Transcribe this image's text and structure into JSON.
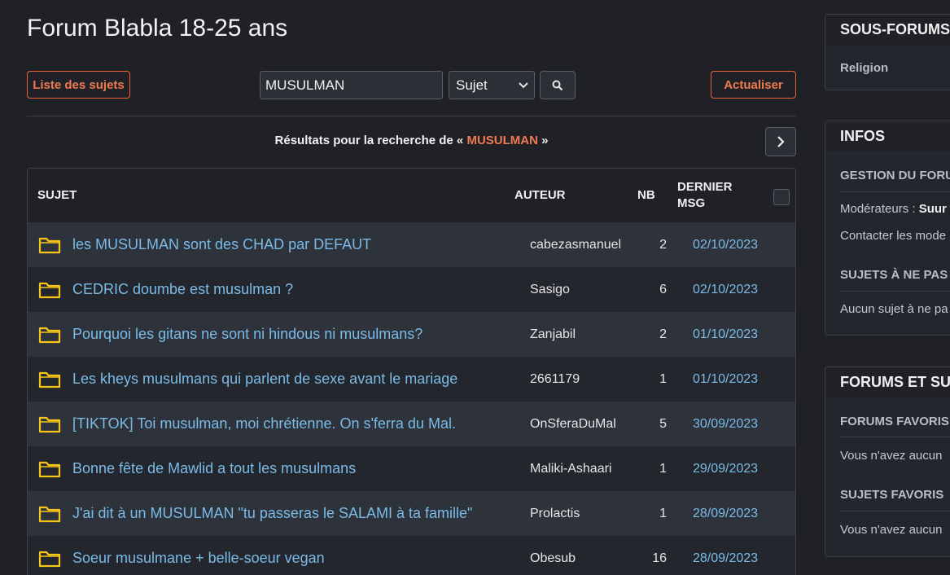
{
  "header": {
    "title": "Forum Blabla 18-25 ans"
  },
  "toolbar": {
    "list_label": "Liste des sujets",
    "search_value": "MUSULMAN",
    "search_type": "Sujet",
    "refresh_label": "Actualiser"
  },
  "results": {
    "prefix": "Résultats pour la recherche de «",
    "term": "MUSULMAN",
    "suffix": "»"
  },
  "table": {
    "headers": {
      "sujet": "SUJET",
      "auteur": "AUTEUR",
      "nb": "NB",
      "dernier_1": "DERNIER",
      "dernier_2": "MSG"
    },
    "rows": [
      {
        "subject": "les MUSULMAN sont des CHAD par DEFAUT",
        "author": "cabezasmanuel",
        "nb": "2",
        "date": "02/10/2023"
      },
      {
        "subject": "CEDRIC doumbe est musulman ?",
        "author": "Sasigo",
        "nb": "6",
        "date": "02/10/2023"
      },
      {
        "subject": "Pourquoi les gitans ne sont ni hindous ni musulmans?",
        "author": "Zanjabil",
        "nb": "2",
        "date": "01/10/2023"
      },
      {
        "subject": "Les kheys musulmans qui parlent de sexe avant le mariage",
        "author": "2661179",
        "nb": "1",
        "date": "01/10/2023"
      },
      {
        "subject": "[TIKTOK] Toi musulman, moi chrétienne. On s'ferra du Mal.",
        "author": "OnSferaDuMal",
        "nb": "5",
        "date": "30/09/2023"
      },
      {
        "subject": "Bonne fête de Mawlid a tout les musulmans",
        "author": "Maliki-Ashaari",
        "nb": "1",
        "date": "29/09/2023"
      },
      {
        "subject": "J'ai dit à un MUSULMAN \"tu passeras le SALAMI à ta famille\"",
        "author": "Prolactis",
        "nb": "1",
        "date": "28/09/2023"
      },
      {
        "subject": "Soeur musulmane + belle-soeur vegan",
        "author": "Obesub",
        "nb": "16",
        "date": "28/09/2023"
      }
    ]
  },
  "sidebar": {
    "sous_forums": {
      "title": "SOUS-FORUMS",
      "item": "Religion"
    },
    "infos": {
      "title": "INFOS",
      "gestion": "GESTION DU FORU",
      "moderateurs_label": "Modérateurs :",
      "moderateurs_name": "Suur",
      "contact": "Contacter les mode",
      "sujets_title": "SUJETS À NE PAS",
      "sujets_text": "Aucun sujet à ne pa"
    },
    "forums": {
      "title": "FORUMS ET SUJ",
      "favoris_forums": "FORUMS FAVORIS",
      "favoris_forums_text": "Vous n'avez aucun",
      "favoris_sujets": "SUJETS FAVORIS",
      "favoris_sujets_text": "Vous n'avez aucun"
    }
  },
  "colors": {
    "accent": "#f07a4f",
    "link": "#7bbbe8",
    "folder": "#f5c518",
    "background": "#1f2126"
  },
  "icons": {
    "search": "search-icon",
    "next": "chevron-right-icon",
    "folder": "folder-icon",
    "dropdown": "chevron-down-icon"
  }
}
